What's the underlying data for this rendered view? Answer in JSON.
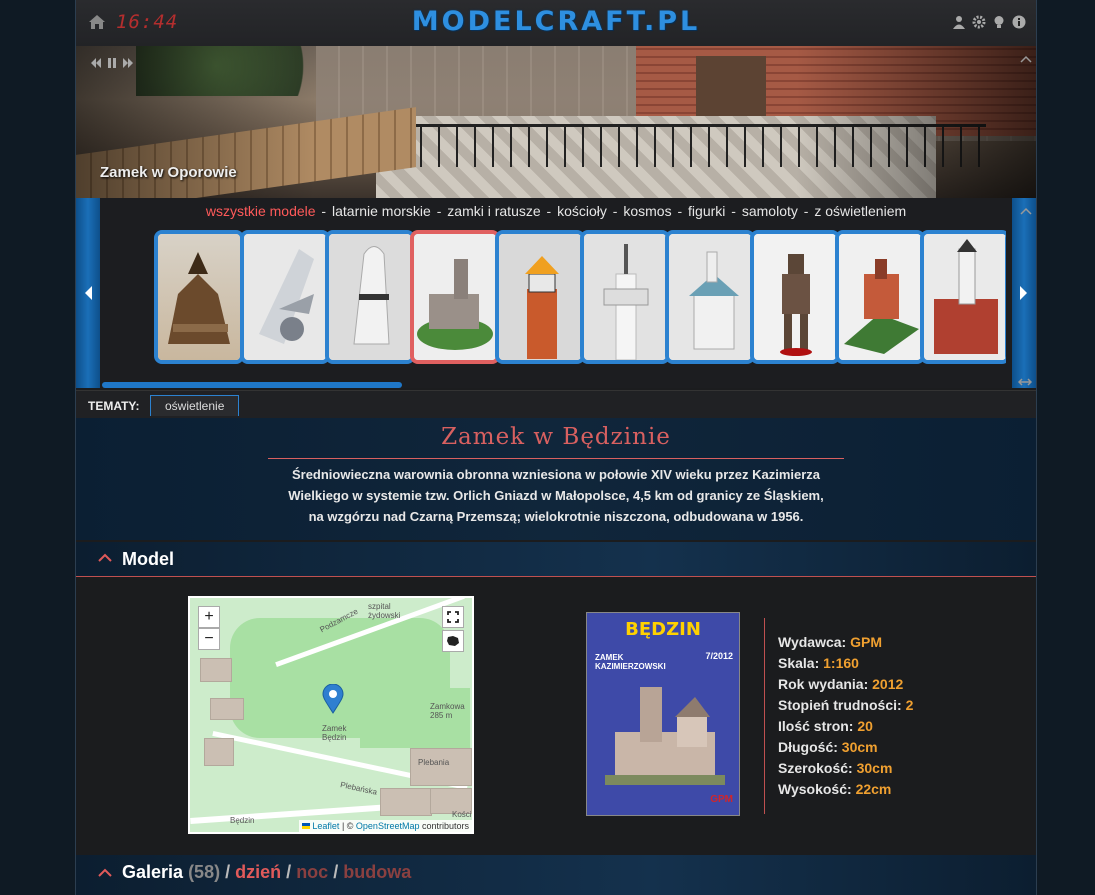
{
  "header": {
    "time": "16:44",
    "logo": "MODELCRAFT.PL",
    "icons": [
      "home-icon",
      "user-icon",
      "gear-icon",
      "lightbulb-icon",
      "info-icon"
    ]
  },
  "hero": {
    "caption": "Zamek w Oporowie",
    "controls": [
      "rewind-icon",
      "pause-icon",
      "forward-icon"
    ]
  },
  "categories": {
    "items": [
      {
        "label": "wszystkie modele",
        "active": true
      },
      {
        "label": "latarnie morskie",
        "active": false
      },
      {
        "label": "zamki i ratusze",
        "active": false
      },
      {
        "label": "kościoły",
        "active": false
      },
      {
        "label": "kosmos",
        "active": false
      },
      {
        "label": "figurki",
        "active": false
      },
      {
        "label": "samoloty",
        "active": false
      },
      {
        "label": "z oświetleniem",
        "active": false
      }
    ],
    "separator": "-",
    "thumbnails": [
      {
        "name": "wooden church",
        "selected": false
      },
      {
        "name": "space shuttle",
        "selected": false
      },
      {
        "name": "capsule",
        "selected": false
      },
      {
        "name": "castle on hill",
        "selected": true
      },
      {
        "name": "lighthouse",
        "selected": false
      },
      {
        "name": "white tower",
        "selected": false
      },
      {
        "name": "chapel",
        "selected": false
      },
      {
        "name": "predator figure",
        "selected": false
      },
      {
        "name": "castle diorama",
        "selected": false
      },
      {
        "name": "town hall",
        "selected": false
      }
    ]
  },
  "topics": {
    "label": "TEMATY:",
    "chip": "oświetlenie"
  },
  "model": {
    "title": "Zamek w Będzinie",
    "description_lines": [
      "Średniowieczna warownia obronna wzniesiona w połowie XIV wieku przez Kazimierza",
      "Wielkiego w systemie tzw. Orlich Gniazd w Małopolsce, 4,5 km od granicy ze Śląskiem,",
      "na wzgórzu nad Czarną Przemszą; wielokrotnie niszczona, odbudowana w 1956."
    ],
    "section_label": "Model",
    "map": {
      "zoom_in": "+",
      "zoom_out": "−",
      "labels": {
        "podzamcze": "Podzamcze",
        "szpital": "szpital\nżydowski",
        "zamek": "Zamek\nBędzin",
        "zamkowa": "Zamkowa\n285 m",
        "plebania": "Plebania",
        "plebanska": "Plebańska",
        "bedzin": "Będzin",
        "koscio": "Kościo"
      },
      "attribution_leaflet": "Leaflet",
      "attribution_sep": " | © ",
      "attribution_osm": "OpenStreetMap",
      "attribution_tail": " contributors"
    },
    "cover": {
      "title": "BĘDZIN",
      "subtitle": "ZAMEK\nKAZIMIERZOWSKI",
      "issue": "7/2012",
      "brand": "GPM"
    },
    "specs": [
      {
        "label": "Wydawca:",
        "value": "GPM"
      },
      {
        "label": "Skala:",
        "value": "1:160"
      },
      {
        "label": "Rok wydania:",
        "value": "2012"
      },
      {
        "label": "Stopień trudności:",
        "value": "2"
      },
      {
        "label": "Ilość stron:",
        "value": "20"
      },
      {
        "label": "Długość:",
        "value": "30cm"
      },
      {
        "label": "Szerokość:",
        "value": "30cm"
      },
      {
        "label": "Wysokość:",
        "value": "22cm"
      }
    ]
  },
  "gallery": {
    "label": "Galeria",
    "count": "(58)",
    "filters": [
      "dzień",
      "noc",
      "budowa"
    ],
    "separator": "/"
  },
  "colors": {
    "accent_blue": "#2c82d0",
    "accent_red": "#d86060",
    "value_orange": "#f0a030"
  }
}
